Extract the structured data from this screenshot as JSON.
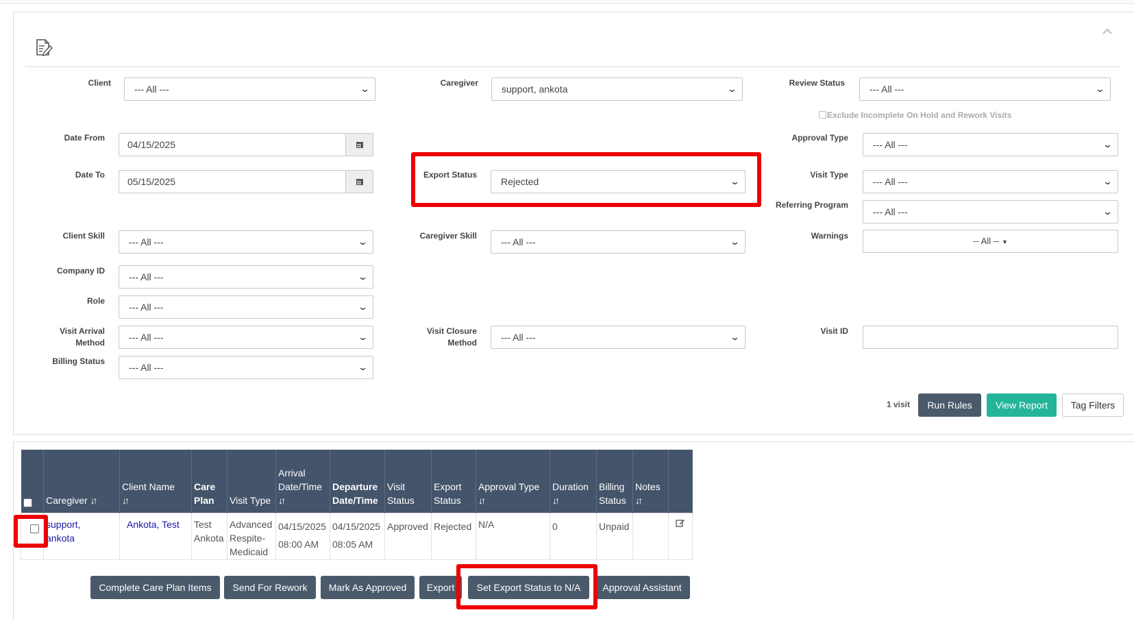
{
  "filters": {
    "client": {
      "label": "Client",
      "value": "--- All ---"
    },
    "caregiver": {
      "label": "Caregiver",
      "value": "support, ankota"
    },
    "review_status": {
      "label": "Review Status",
      "value": "--- All ---"
    },
    "exclude_incomplete": {
      "label": "Exclude Incomplete On Hold and Rework Visits",
      "checked": false
    },
    "date_from": {
      "label": "Date From",
      "value": "04/15/2025"
    },
    "date_to": {
      "label": "Date To",
      "value": "05/15/2025"
    },
    "export_status": {
      "label": "Export Status",
      "value": "Rejected"
    },
    "approval_type": {
      "label": "Approval Type",
      "value": "--- All ---"
    },
    "visit_type": {
      "label": "Visit Type",
      "value": "--- All ---"
    },
    "referring_program": {
      "label": "Referring Program",
      "value": "--- All ---"
    },
    "client_skill": {
      "label": "Client Skill",
      "value": "--- All ---"
    },
    "caregiver_skill": {
      "label": "Caregiver Skill",
      "value": "--- All ---"
    },
    "warnings": {
      "label": "Warnings",
      "value": "-- All --"
    },
    "company_id": {
      "label": "Company ID",
      "value": "--- All ---"
    },
    "role": {
      "label": "Role",
      "value": "--- All ---"
    },
    "visit_arrival_method": {
      "label_line1": "Visit Arrival",
      "label_line2": "Method",
      "value": "--- All ---"
    },
    "visit_closure_method": {
      "label_line1": "Visit Closure",
      "label_line2": "Method",
      "value": "--- All ---"
    },
    "visit_id": {
      "label": "Visit ID",
      "value": ""
    },
    "billing_status": {
      "label": "Billing Status",
      "value": "--- All ---"
    }
  },
  "toolbar": {
    "count_text": "1 visit",
    "run_rules": "Run Rules",
    "view_report": "View Report",
    "tag_filters": "Tag Filters"
  },
  "table": {
    "headers": {
      "caregiver": "Caregiver",
      "client_name": "Client Name",
      "care_plan_1": "Care",
      "care_plan_2": "Plan",
      "visit_type": "Visit Type",
      "arrival_1": "Arrival",
      "arrival_2": "Date/Time",
      "departure_1": "Departure",
      "departure_2": "Date/Time",
      "visit_status_1": "Visit",
      "visit_status_2": "Status",
      "export_status_1": "Export",
      "export_status_2": "Status",
      "approval_type": "Approval Type",
      "duration": "Duration",
      "billing_status_1": "Billing",
      "billing_status_2": "Status",
      "notes": "Notes",
      "sort_glyph": "↓↑"
    },
    "rows": [
      {
        "caregiver_1": "support,",
        "caregiver_2": "ankota",
        "client_name": "Ankota, Test",
        "care_plan_1": "Test",
        "care_plan_2": "Ankota",
        "visit_type_1": "Advanced",
        "visit_type_2": "Respite-",
        "visit_type_3": "Medicaid",
        "arrival_date": "04/15/2025",
        "arrival_time": "08:00 AM",
        "departure_date": "04/15/2025",
        "departure_time": "08:05 AM",
        "visit_status": "Approved",
        "export_status": "Rejected",
        "approval_type": "N/A",
        "duration": "0",
        "billing_status": "Unpaid",
        "notes": ""
      }
    ]
  },
  "actions": {
    "complete_care_plan": "Complete Care Plan Items",
    "send_for_rework": "Send For Rework",
    "mark_as_approved": "Mark As Approved",
    "export": "Export",
    "set_export_na": "Set Export Status to N/A",
    "approval_assistant": "Approval Assistant"
  },
  "colors": {
    "header_bg": "#44546a",
    "button_bg": "#4a5a6b",
    "teal": "#22b59a",
    "highlight_red": "#ee0000",
    "link": "#1a1aa6"
  },
  "icons": [
    "report-edit-icon",
    "collapse-chevron-icon",
    "calendar-icon",
    "chevron-down-icon",
    "sort-icon",
    "edit-note-icon",
    "caret-down-icon"
  ]
}
